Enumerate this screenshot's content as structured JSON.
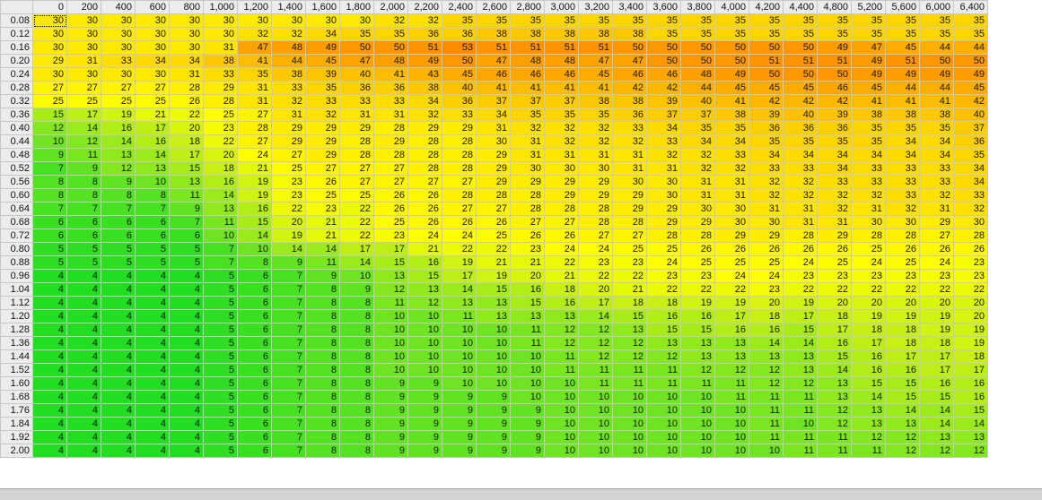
{
  "table": {
    "columns": [
      "0",
      "200",
      "400",
      "600",
      "800",
      "1,000",
      "1,200",
      "1,400",
      "1,600",
      "1,800",
      "2,000",
      "2,200",
      "2,400",
      "2,600",
      "2,800",
      "3,000",
      "3,200",
      "3,400",
      "3,600",
      "3,800",
      "4,000",
      "4,200",
      "4,400",
      "4,800",
      "5,200",
      "5,600",
      "6,000",
      "6,400"
    ],
    "rows": [
      {
        "label": "0.08",
        "values": [
          30,
          30,
          30,
          30,
          30,
          30,
          30,
          30,
          30,
          30,
          32,
          32,
          35,
          35,
          35,
          35,
          35,
          35,
          35,
          35,
          35,
          35,
          35,
          35,
          35,
          35,
          35,
          35
        ]
      },
      {
        "label": "0.12",
        "values": [
          30,
          30,
          30,
          30,
          30,
          30,
          32,
          32,
          34,
          35,
          35,
          36,
          36,
          38,
          38,
          38,
          38,
          38,
          35,
          35,
          35,
          35,
          35,
          35,
          35,
          35,
          35,
          35
        ]
      },
      {
        "label": "0.16",
        "values": [
          30,
          30,
          30,
          30,
          30,
          31,
          47,
          48,
          49,
          50,
          50,
          51,
          53,
          51,
          51,
          51,
          51,
          50,
          50,
          50,
          50,
          50,
          50,
          49,
          47,
          45,
          44,
          44
        ]
      },
      {
        "label": "0.20",
        "values": [
          29,
          31,
          33,
          34,
          34,
          38,
          41,
          44,
          45,
          47,
          48,
          49,
          50,
          47,
          48,
          48,
          47,
          47,
          50,
          50,
          50,
          51,
          51,
          51,
          49,
          51,
          50,
          50
        ]
      },
      {
        "label": "0.24",
        "values": [
          30,
          30,
          30,
          30,
          31,
          33,
          35,
          38,
          39,
          40,
          41,
          43,
          45,
          46,
          46,
          46,
          45,
          46,
          46,
          48,
          49,
          50,
          50,
          50,
          49,
          49,
          49,
          49
        ]
      },
      {
        "label": "0.28",
        "values": [
          27,
          27,
          27,
          27,
          28,
          29,
          31,
          33,
          35,
          36,
          36,
          38,
          40,
          41,
          41,
          41,
          41,
          42,
          42,
          44,
          45,
          45,
          45,
          46,
          45,
          44,
          44,
          45
        ]
      },
      {
        "label": "0.32",
        "values": [
          25,
          25,
          25,
          25,
          26,
          28,
          31,
          32,
          33,
          33,
          33,
          34,
          36,
          37,
          37,
          37,
          38,
          38,
          39,
          40,
          41,
          42,
          42,
          42,
          41,
          41,
          41,
          42
        ]
      },
      {
        "label": "0.36",
        "values": [
          15,
          17,
          19,
          21,
          22,
          25,
          27,
          31,
          32,
          31,
          31,
          32,
          33,
          34,
          35,
          35,
          35,
          36,
          37,
          37,
          38,
          39,
          40,
          39,
          38,
          38,
          38,
          40
        ]
      },
      {
        "label": "0.40",
        "values": [
          12,
          14,
          16,
          17,
          20,
          23,
          28,
          29,
          29,
          29,
          28,
          29,
          29,
          31,
          32,
          32,
          32,
          33,
          34,
          35,
          35,
          36,
          36,
          36,
          35,
          35,
          35,
          37
        ]
      },
      {
        "label": "0.44",
        "values": [
          10,
          12,
          14,
          16,
          18,
          22,
          27,
          29,
          29,
          28,
          29,
          28,
          28,
          30,
          31,
          32,
          32,
          32,
          33,
          34,
          34,
          35,
          35,
          35,
          35,
          34,
          34,
          36
        ]
      },
      {
        "label": "0.48",
        "values": [
          9,
          11,
          13,
          14,
          17,
          20,
          24,
          27,
          29,
          28,
          28,
          28,
          28,
          29,
          31,
          31,
          31,
          31,
          32,
          32,
          33,
          34,
          34,
          34,
          34,
          34,
          34,
          35
        ]
      },
      {
        "label": "0.52",
        "values": [
          7,
          9,
          12,
          13,
          15,
          18,
          21,
          25,
          27,
          27,
          27,
          28,
          28,
          29,
          30,
          30,
          30,
          31,
          31,
          32,
          32,
          33,
          33,
          34,
          33,
          33,
          33,
          34
        ]
      },
      {
        "label": "0.56",
        "values": [
          8,
          8,
          9,
          10,
          13,
          16,
          19,
          23,
          26,
          27,
          27,
          27,
          27,
          29,
          29,
          29,
          29,
          30,
          30,
          31,
          31,
          32,
          32,
          33,
          33,
          33,
          33,
          34
        ]
      },
      {
        "label": "0.60",
        "values": [
          8,
          8,
          8,
          8,
          11,
          14,
          19,
          23,
          25,
          25,
          26,
          26,
          28,
          28,
          28,
          29,
          29,
          29,
          30,
          31,
          31,
          32,
          32,
          32,
          32,
          33,
          32,
          33
        ]
      },
      {
        "label": "0.64",
        "values": [
          7,
          7,
          7,
          7,
          9,
          13,
          16,
          22,
          23,
          22,
          26,
          26,
          27,
          27,
          28,
          28,
          28,
          29,
          29,
          30,
          30,
          31,
          31,
          32,
          31,
          32,
          31,
          32
        ]
      },
      {
        "label": "0.68",
        "values": [
          6,
          6,
          6,
          6,
          7,
          11,
          15,
          20,
          21,
          22,
          25,
          26,
          26,
          26,
          27,
          27,
          28,
          28,
          29,
          29,
          30,
          30,
          31,
          31,
          30,
          30,
          29,
          30
        ]
      },
      {
        "label": "0.72",
        "values": [
          6,
          6,
          6,
          6,
          6,
          10,
          14,
          19,
          21,
          22,
          23,
          24,
          24,
          25,
          26,
          26,
          27,
          27,
          28,
          28,
          29,
          29,
          28,
          29,
          28,
          28,
          27,
          28
        ]
      },
      {
        "label": "0.80",
        "values": [
          5,
          5,
          5,
          5,
          5,
          7,
          10,
          14,
          14,
          17,
          17,
          21,
          22,
          22,
          23,
          24,
          24,
          25,
          25,
          26,
          26,
          26,
          26,
          26,
          25,
          26,
          26,
          26
        ]
      },
      {
        "label": "0.88",
        "values": [
          5,
          5,
          5,
          5,
          5,
          7,
          8,
          9,
          11,
          14,
          15,
          16,
          19,
          21,
          21,
          22,
          23,
          23,
          24,
          25,
          25,
          25,
          24,
          25,
          24,
          25,
          24,
          23
        ]
      },
      {
        "label": "0.96",
        "values": [
          4,
          4,
          4,
          4,
          4,
          5,
          6,
          7,
          9,
          10,
          13,
          15,
          17,
          19,
          20,
          21,
          22,
          22,
          23,
          23,
          24,
          24,
          23,
          23,
          23,
          23,
          23,
          23
        ]
      },
      {
        "label": "1.04",
        "values": [
          4,
          4,
          4,
          4,
          4,
          5,
          6,
          7,
          8,
          9,
          12,
          13,
          14,
          15,
          16,
          18,
          20,
          21,
          22,
          22,
          22,
          23,
          22,
          22,
          22,
          22,
          22,
          22
        ]
      },
      {
        "label": "1.12",
        "values": [
          4,
          4,
          4,
          4,
          4,
          5,
          6,
          7,
          8,
          8,
          11,
          12,
          13,
          13,
          15,
          16,
          17,
          18,
          18,
          19,
          19,
          20,
          19,
          20,
          20,
          20,
          20,
          20
        ]
      },
      {
        "label": "1.20",
        "values": [
          4,
          4,
          4,
          4,
          4,
          5,
          6,
          7,
          8,
          8,
          10,
          10,
          11,
          13,
          13,
          13,
          14,
          15,
          16,
          16,
          17,
          18,
          17,
          18,
          19,
          19,
          19,
          20
        ]
      },
      {
        "label": "1.28",
        "values": [
          4,
          4,
          4,
          4,
          4,
          5,
          6,
          7,
          8,
          8,
          10,
          10,
          10,
          10,
          11,
          12,
          12,
          13,
          15,
          15,
          16,
          16,
          15,
          17,
          18,
          18,
          19,
          19
        ]
      },
      {
        "label": "1.36",
        "values": [
          4,
          4,
          4,
          4,
          4,
          5,
          6,
          7,
          8,
          8,
          10,
          10,
          10,
          10,
          11,
          12,
          12,
          12,
          13,
          13,
          13,
          14,
          14,
          16,
          17,
          18,
          18,
          19
        ]
      },
      {
        "label": "1.44",
        "values": [
          4,
          4,
          4,
          4,
          4,
          5,
          6,
          7,
          8,
          8,
          10,
          10,
          10,
          10,
          10,
          11,
          12,
          12,
          12,
          13,
          13,
          13,
          13,
          15,
          16,
          17,
          17,
          18
        ]
      },
      {
        "label": "1.52",
        "values": [
          4,
          4,
          4,
          4,
          4,
          5,
          6,
          7,
          8,
          8,
          10,
          10,
          10,
          10,
          10,
          11,
          11,
          11,
          11,
          12,
          12,
          12,
          13,
          14,
          16,
          16,
          17,
          17
        ]
      },
      {
        "label": "1.60",
        "values": [
          4,
          4,
          4,
          4,
          4,
          5,
          6,
          7,
          8,
          8,
          9,
          9,
          10,
          10,
          10,
          10,
          11,
          11,
          11,
          11,
          11,
          12,
          12,
          13,
          15,
          15,
          16,
          16
        ]
      },
      {
        "label": "1.68",
        "values": [
          4,
          4,
          4,
          4,
          4,
          5,
          6,
          7,
          8,
          8,
          9,
          9,
          9,
          9,
          10,
          10,
          10,
          10,
          10,
          10,
          11,
          11,
          11,
          13,
          14,
          15,
          15,
          16
        ]
      },
      {
        "label": "1.76",
        "values": [
          4,
          4,
          4,
          4,
          4,
          5,
          6,
          7,
          8,
          8,
          9,
          9,
          9,
          9,
          9,
          10,
          10,
          10,
          10,
          10,
          10,
          11,
          11,
          12,
          13,
          14,
          14,
          15
        ]
      },
      {
        "label": "1.84",
        "values": [
          4,
          4,
          4,
          4,
          4,
          5,
          6,
          7,
          8,
          8,
          9,
          9,
          9,
          9,
          9,
          10,
          10,
          10,
          10,
          10,
          10,
          11,
          10,
          12,
          13,
          13,
          14,
          14
        ]
      },
      {
        "label": "1.92",
        "values": [
          4,
          4,
          4,
          4,
          4,
          5,
          6,
          7,
          8,
          8,
          9,
          9,
          9,
          9,
          9,
          10,
          10,
          10,
          10,
          10,
          10,
          11,
          11,
          11,
          12,
          12,
          13,
          13
        ]
      },
      {
        "label": "2.00",
        "values": [
          4,
          4,
          4,
          4,
          4,
          5,
          6,
          7,
          8,
          8,
          9,
          9,
          9,
          9,
          9,
          10,
          10,
          10,
          10,
          10,
          10,
          10,
          11,
          11,
          11,
          12,
          12,
          12
        ]
      }
    ]
  },
  "colors": {
    "low": "#22dd22",
    "mid_green": "#aaee22",
    "yellow": "#ffff00",
    "gold": "#ffd000",
    "orange": "#ff9900",
    "header_bg": "#ececec",
    "grid_line": "#c8c8c8"
  },
  "selected_cell": {
    "row": 0,
    "col": 0
  }
}
